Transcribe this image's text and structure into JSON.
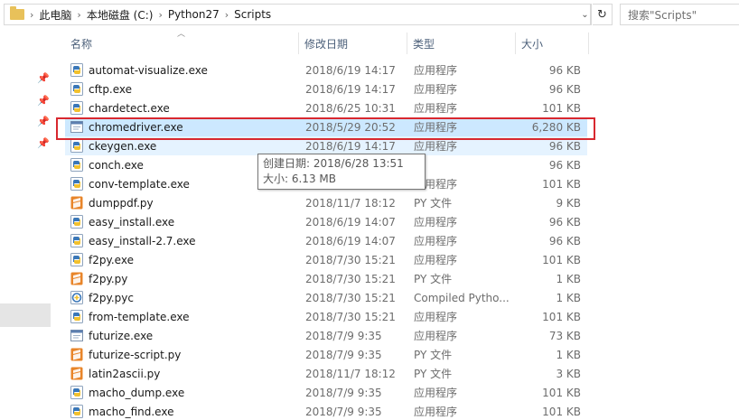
{
  "address": {
    "crumbs": [
      "此电脑",
      "本地磁盘 (C:)",
      "Python27",
      "Scripts"
    ],
    "search_placeholder": "搜索\"Scripts\""
  },
  "columns": {
    "name": "名称",
    "date": "修改日期",
    "type": "类型",
    "size": "大小"
  },
  "rows": [
    {
      "name": "automat-visualize.exe",
      "date": "2018/6/19 14:17",
      "type": "应用程序",
      "size": "96 KB",
      "icon": "python-exe-icon"
    },
    {
      "name": "cftp.exe",
      "date": "2018/6/19 14:17",
      "type": "应用程序",
      "size": "96 KB",
      "icon": "python-exe-icon"
    },
    {
      "name": "chardetect.exe",
      "date": "2018/6/25 10:31",
      "type": "应用程序",
      "size": "101 KB",
      "icon": "python-exe-icon"
    },
    {
      "name": "chromedriver.exe",
      "date": "2018/5/29 20:52",
      "type": "应用程序",
      "size": "6,280 KB",
      "icon": "exe-window-icon"
    },
    {
      "name": "ckeygen.exe",
      "date": "2018/6/19 14:17",
      "type": "应用程序",
      "size": "96 KB",
      "icon": "python-exe-icon"
    },
    {
      "name": "conch.exe",
      "date": "",
      "type": "",
      "size": "96 KB",
      "icon": "python-exe-icon"
    },
    {
      "name": "conv-template.exe",
      "date": "",
      "type": "应用程序",
      "size": "101 KB",
      "icon": "python-exe-icon"
    },
    {
      "name": "dumppdf.py",
      "date": "2018/11/7 18:12",
      "type": "PY 文件",
      "size": "9 KB",
      "icon": "sublime-file-icon"
    },
    {
      "name": "easy_install.exe",
      "date": "2018/6/19 14:07",
      "type": "应用程序",
      "size": "96 KB",
      "icon": "python-exe-icon"
    },
    {
      "name": "easy_install-2.7.exe",
      "date": "2018/6/19 14:07",
      "type": "应用程序",
      "size": "96 KB",
      "icon": "python-exe-icon"
    },
    {
      "name": "f2py.exe",
      "date": "2018/7/30 15:21",
      "type": "应用程序",
      "size": "101 KB",
      "icon": "python-exe-icon"
    },
    {
      "name": "f2py.py",
      "date": "2018/7/30 15:21",
      "type": "PY 文件",
      "size": "1 KB",
      "icon": "sublime-file-icon"
    },
    {
      "name": "f2py.pyc",
      "date": "2018/7/30 15:21",
      "type": "Compiled Pytho...",
      "size": "1 KB",
      "icon": "python-compiled-icon"
    },
    {
      "name": "from-template.exe",
      "date": "2018/7/30 15:21",
      "type": "应用程序",
      "size": "101 KB",
      "icon": "python-exe-icon"
    },
    {
      "name": "futurize.exe",
      "date": "2018/7/9 9:35",
      "type": "应用程序",
      "size": "73 KB",
      "icon": "exe-window-icon"
    },
    {
      "name": "futurize-script.py",
      "date": "2018/7/9 9:35",
      "type": "PY 文件",
      "size": "1 KB",
      "icon": "sublime-file-icon"
    },
    {
      "name": "latin2ascii.py",
      "date": "2018/11/7 18:12",
      "type": "PY 文件",
      "size": "3 KB",
      "icon": "sublime-file-icon"
    },
    {
      "name": "macho_dump.exe",
      "date": "2018/7/9 9:35",
      "type": "应用程序",
      "size": "101 KB",
      "icon": "python-exe-icon"
    },
    {
      "name": "macho_find.exe",
      "date": "2018/7/9 9:35",
      "type": "应用程序",
      "size": "101 KB",
      "icon": "python-exe-icon"
    }
  ],
  "selected_index": 3,
  "hover_index": 4,
  "tooltip": {
    "created": "创建日期: 2018/6/28 13:51",
    "size": "大小: 6.13 MB"
  },
  "colors": {
    "selected_bg": "#cce8ff",
    "hover_bg": "#e5f3ff",
    "annotation_frame": "#d8282f",
    "header_text": "#4c607a"
  }
}
